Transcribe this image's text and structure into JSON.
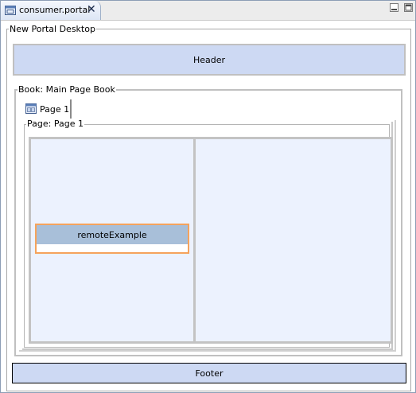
{
  "editor": {
    "tab_title": "consumer.portal",
    "close_glyph": "✕"
  },
  "desktop": {
    "legend": "New Portal Desktop",
    "header_label": "Header",
    "footer_label": "Footer"
  },
  "book": {
    "legend": "Book: Main Page Book",
    "tabs": [
      {
        "label": "Page 1"
      }
    ]
  },
  "page": {
    "legend": "Page: Page 1",
    "portlets": [
      {
        "title": "remoteExample"
      }
    ]
  },
  "icons": {
    "file": "portal-file-icon",
    "page": "page-icon",
    "minimize": "minimize-icon",
    "maximize": "maximize-icon"
  },
  "colors": {
    "region_fill": "#cdd9f3",
    "layout_fill": "#ecf2fe",
    "portlet_title": "#a8bfd9",
    "portlet_selected_border": "#f5a35c"
  }
}
